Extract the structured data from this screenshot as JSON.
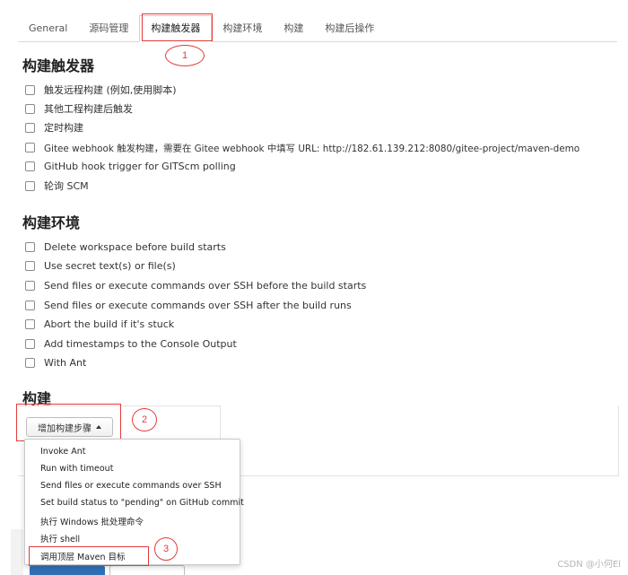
{
  "tabs": [
    {
      "label": "General"
    },
    {
      "label": "源码管理"
    },
    {
      "label": "构建触发器"
    },
    {
      "label": "构建环境"
    },
    {
      "label": "构建"
    },
    {
      "label": "构建后操作"
    }
  ],
  "active_tab": "构建触发器",
  "annotations": {
    "marker_1": "1",
    "marker_2": "2",
    "marker_3": "3",
    "color": "#e23b3b"
  },
  "triggers": {
    "title": "构建触发器",
    "options": [
      {
        "label": "触发远程构建 (例如,使用脚本)",
        "checked": false
      },
      {
        "label": "其他工程构建后触发",
        "checked": false
      },
      {
        "label": "定时构建",
        "checked": false
      },
      {
        "label": "Gitee webhook 触发构建，需要在 Gitee webhook 中填写 URL: http://182.61.139.212:8080/gitee-project/maven-demo",
        "checked": false
      },
      {
        "label": "GitHub hook trigger for GITScm polling",
        "checked": false
      },
      {
        "label": "轮询 SCM",
        "checked": false
      }
    ]
  },
  "environment": {
    "title": "构建环境",
    "options": [
      {
        "label": "Delete workspace before build starts",
        "checked": false
      },
      {
        "label": "Use secret text(s) or file(s)",
        "checked": false
      },
      {
        "label": "Send files or execute commands over SSH before the build starts",
        "checked": false
      },
      {
        "label": "Send files or execute commands over SSH after the build runs",
        "checked": false
      },
      {
        "label": "Abort the build if it's stuck",
        "checked": false
      },
      {
        "label": "Add timestamps to the Console Output",
        "checked": false
      },
      {
        "label": "With Ant",
        "checked": false
      }
    ]
  },
  "build": {
    "title": "构建",
    "add_step_label": "增加构建步骤",
    "menu_items": [
      {
        "label": "Invoke Ant"
      },
      {
        "label": "Run with timeout"
      },
      {
        "label": "Send files or execute commands over SSH"
      },
      {
        "label": "Set build status to \"pending\" on GitHub commit"
      },
      {
        "label": "执行 Windows 批处理命令"
      },
      {
        "label": "执行 shell"
      },
      {
        "label": "调用顶层 Maven 目标"
      }
    ]
  },
  "watermark": "CSDN @小何El"
}
